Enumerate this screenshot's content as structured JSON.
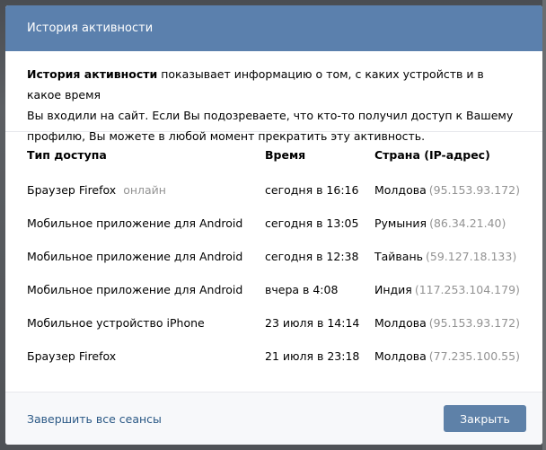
{
  "modal": {
    "title": "История активности",
    "intro_bold": "История активности",
    "intro_line1_rest": " показывает информацию о том, с каких устройств и в какое время",
    "intro_line2": "Вы входили на сайт. Если Вы подозреваете, что кто-то получил доступ к Вашему",
    "intro_line3": "профилю, Вы можете в любой момент прекратить эту активность."
  },
  "table": {
    "headers": [
      "Тип доступа",
      "Время",
      "Страна (IP-адрес)"
    ],
    "rows": [
      {
        "access": "Браузер Firefox",
        "status": "онлайн",
        "time": "сегодня в 16:16",
        "country": "Молдова",
        "ip": "(95.153.93.172)"
      },
      {
        "access": "Мобильное приложение для Android",
        "status": "",
        "time": "сегодня в 13:05",
        "country": "Румыния",
        "ip": "(86.34.21.40)"
      },
      {
        "access": "Мобильное приложение для Android",
        "status": "",
        "time": "сегодня в 12:38",
        "country": "Тайвань",
        "ip": "(59.127.18.133)"
      },
      {
        "access": "Мобильное приложение для Android",
        "status": "",
        "time": "вчера в 4:08",
        "country": "Индия",
        "ip": "(117.253.104.179)"
      },
      {
        "access": "Мобильное устройство iPhone",
        "status": "",
        "time": "23 июля в 14:14",
        "country": "Молдова",
        "ip": "(95.153.93.172)"
      },
      {
        "access": "Браузер Firefox",
        "status": "",
        "time": "21 июля в 23:18",
        "country": "Молдова",
        "ip": "(77.235.100.55)"
      }
    ]
  },
  "footer": {
    "end_sessions_label": "Завершить все сеансы",
    "close_label": "Закрыть"
  },
  "colors": {
    "header_bg": "#5b80ad",
    "button_bg": "#5e81a8",
    "link": "#2a5885",
    "muted": "#939393"
  }
}
